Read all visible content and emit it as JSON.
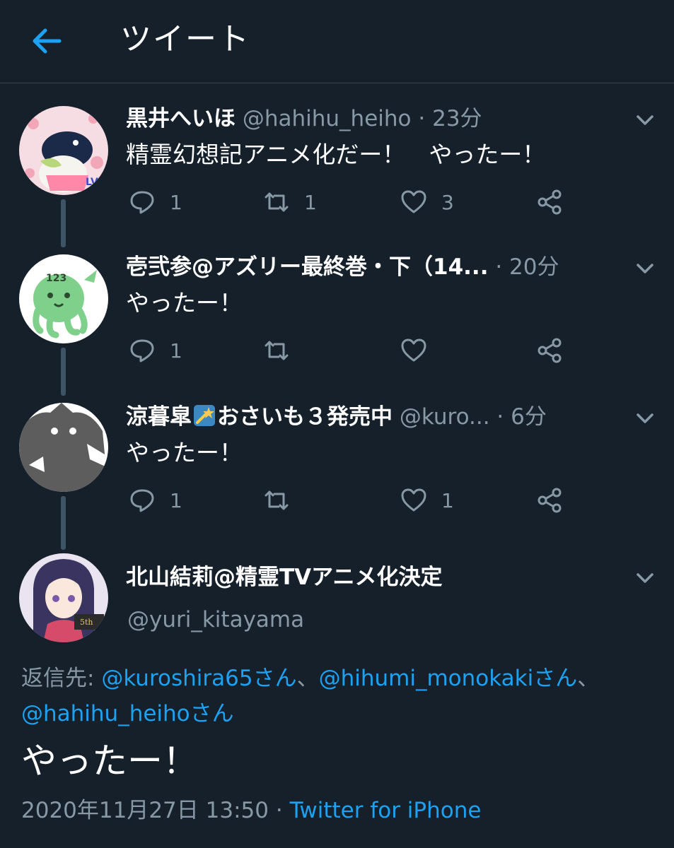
{
  "header": {
    "title": "ツイート",
    "back_icon": "arrow-left-icon",
    "accent": "#1da1f2"
  },
  "tweets": [
    {
      "name": "黒井へいほ",
      "handle": "@hahihu_heiho",
      "sep": "·",
      "time": "23分",
      "text": "精霊幻想記アニメ化だー！　やったー！",
      "reply_count": "1",
      "retweet_count": "1",
      "like_count": "3"
    },
    {
      "name": "壱弐参@アズリー最終巻・下（14...",
      "handle": "",
      "sep": "·",
      "time": "20分",
      "text": "やったー！",
      "reply_count": "1",
      "retweet_count": "",
      "like_count": ""
    },
    {
      "name_prefix": "涼暮皐",
      "name_suffix": "おさいも３発売中",
      "handle": "@kuro...",
      "sep": "·",
      "time": "6分",
      "text": "やったー！",
      "reply_count": "1",
      "retweet_count": "",
      "like_count": "1"
    }
  ],
  "main_tweet": {
    "name": "北山結莉@精霊TVアニメ化決定",
    "handle": "@yuri_kitayama",
    "reply_label": "返信先:",
    "reply_user1": "@kuroshira65さん",
    "reply_sep1": "、",
    "reply_user2": "@hihumi_monokakiさん",
    "reply_sep2": "、",
    "reply_user3": "@hahihu_heihoさん",
    "text": "やったー！",
    "timestamp": "2020年11月27日 13:50",
    "sep": "·",
    "source": "Twitter for iPhone"
  },
  "colors": {
    "background": "#15202b",
    "secondary_text": "#8899a6",
    "link": "#1da1f2",
    "thread_line": "#3d5466"
  }
}
